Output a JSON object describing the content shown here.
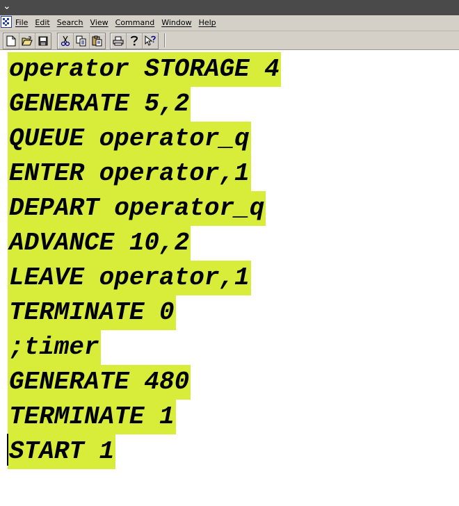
{
  "menubar": {
    "items": [
      {
        "label": "File"
      },
      {
        "label": "Edit"
      },
      {
        "label": "Search"
      },
      {
        "label": "View"
      },
      {
        "label": "Command"
      },
      {
        "label": "Window"
      },
      {
        "label": "Help"
      }
    ]
  },
  "toolbar": {
    "buttons": [
      "new-icon",
      "open-icon",
      "save-icon",
      "cut-icon",
      "copy-icon",
      "paste-icon",
      "print-icon",
      "help-icon",
      "context-help-icon"
    ]
  },
  "editor": {
    "highlight_color": "#d8ec3a",
    "lines": [
      "operator STORAGE 4",
      "GENERATE 5,2",
      "QUEUE operator_q",
      "ENTER operator,1",
      "DEPART operator_q",
      "ADVANCE 10,2",
      "LEAVE operator,1",
      "TERMINATE 0",
      ";timer",
      "GENERATE 480",
      "TERMINATE 1",
      "START 1"
    ]
  }
}
